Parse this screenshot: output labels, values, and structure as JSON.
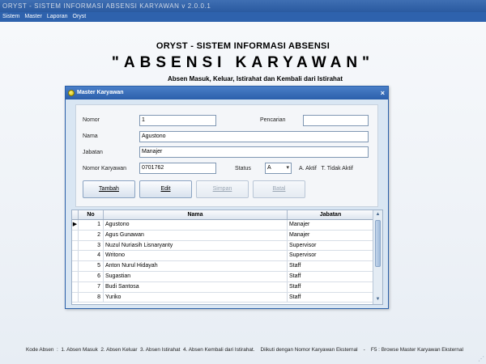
{
  "app": {
    "title": "ORYST - SISTEM INFORMASI ABSENSI KARYAWAN v 2.0.0.1",
    "menu": [
      "Sistem",
      "Master",
      "Laporan",
      "Oryst"
    ]
  },
  "hero": {
    "line1": "ORYST - SISTEM INFORMASI ABSENSI",
    "line2": "\"ABSENSI KARYAWAN\"",
    "line3": "Absen Masuk, Keluar, Istirahat dan Kembali dari Istirahat"
  },
  "window": {
    "title": "Master Karyawan",
    "close": "×",
    "form": {
      "nomor_label": "Nomor",
      "nomor_value": "1",
      "pencarian_label": "Pencarian",
      "pencarian_value": "",
      "nama_label": "Nama",
      "nama_value": "Agustono",
      "jabatan_label": "Jabatan",
      "jabatan_value": "Manajer",
      "nomor_karyawan_label": "Nomor Karyawan",
      "nomor_karyawan_value": "0701762",
      "status_label": "Status",
      "status_value": "A",
      "status_legend": "A. Aktif   T. Tidak Aktif"
    },
    "buttons": {
      "tambah": "Tambah",
      "edit": "Edit",
      "simpan": "Simpan",
      "batal": "Batal"
    },
    "grid": {
      "headers": [
        "No",
        "Nama",
        "Jabatan"
      ],
      "rows": [
        {
          "no": "1",
          "nama": "Agustono",
          "jabatan": "Manajer"
        },
        {
          "no": "2",
          "nama": "Agus Gunawan",
          "jabatan": "Manajer"
        },
        {
          "no": "3",
          "nama": "Nuzul Nuriasih Lisnaryanty",
          "jabatan": "Supervisor"
        },
        {
          "no": "4",
          "nama": "Writono",
          "jabatan": "Supervisor"
        },
        {
          "no": "5",
          "nama": "Anton Nurul Hidayah",
          "jabatan": "Staff"
        },
        {
          "no": "6",
          "nama": "Sugastian",
          "jabatan": "Staff"
        },
        {
          "no": "7",
          "nama": "Budi Santosa",
          "jabatan": "Staff"
        },
        {
          "no": "8",
          "nama": "Yuriko",
          "jabatan": "Staff"
        }
      ]
    }
  },
  "statusbar": {
    "text": "Kode Absen  :  1. Absen Masuk  2. Absen Keluar  3. Absen Istirahat  4. Absen Kembali dari Istirahat.    Diikuti dengan Nomor Karyawan Eksternal    -    F5 : Browse Master Karyawan Eksternal"
  },
  "colors": {
    "titlebar": "#2a5aa0",
    "menubar": "#2e62ad",
    "window_border": "#2a5fa8",
    "window_bg": "#d9e6f3"
  }
}
